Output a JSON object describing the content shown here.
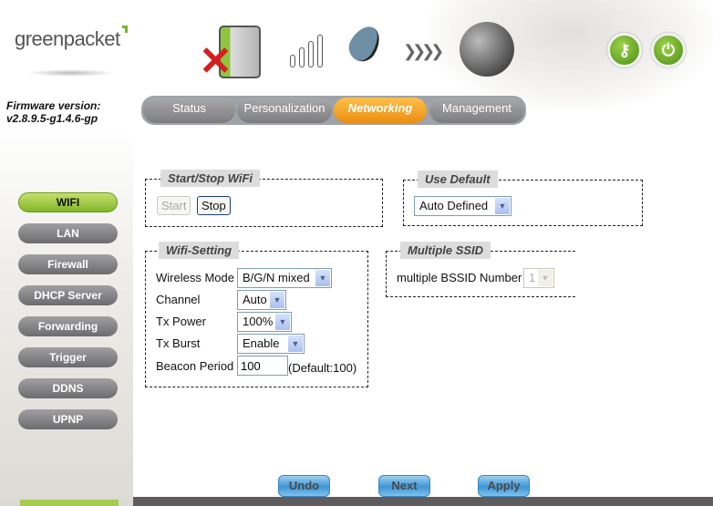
{
  "brand": {
    "logo": "greenpacket"
  },
  "firmware": {
    "label": "Firmware version:",
    "version": "v2.8.9.5-g1.4.6-gp"
  },
  "status_icons": [
    "device-disconnected-icon",
    "signal-bars-icon",
    "satellite-dish-icon",
    "arrows-icon",
    "globe-icon"
  ],
  "header_buttons": [
    {
      "icon": "key-icon"
    },
    {
      "icon": "power-icon"
    }
  ],
  "tabs": [
    {
      "label": "Status"
    },
    {
      "label": "Personalization"
    },
    {
      "label": "Networking",
      "active": true
    },
    {
      "label": "Management"
    }
  ],
  "sidebar": {
    "items": [
      {
        "label": "WIFI",
        "active": true
      },
      {
        "label": "LAN"
      },
      {
        "label": "Firewall"
      },
      {
        "label": "DHCP Server"
      },
      {
        "label": "Forwarding"
      },
      {
        "label": "Trigger"
      },
      {
        "label": "DDNS"
      },
      {
        "label": "UPNP"
      }
    ]
  },
  "start_stop": {
    "legend": "Start/Stop WiFi",
    "start": "Start",
    "stop": "Stop"
  },
  "use_default": {
    "legend": "Use Default",
    "value": "Auto Defined"
  },
  "wifi_setting": {
    "legend": "Wifi-Setting",
    "wireless_mode": {
      "label": "Wireless Mode",
      "value": "B/G/N mixed"
    },
    "channel": {
      "label": "Channel",
      "value": "Auto"
    },
    "tx_power": {
      "label": "Tx Power",
      "value": "100%"
    },
    "tx_burst": {
      "label": "Tx Burst",
      "value": "Enable"
    },
    "beacon_period": {
      "label": "Beacon Period",
      "value": "100",
      "hint": "(Default:100)"
    }
  },
  "multiple_ssid": {
    "legend": "Multiple SSID",
    "label": "multiple BSSID Number",
    "value": "1"
  },
  "footer": {
    "undo": "Undo",
    "next": "Next",
    "apply": "Apply"
  },
  "colors": {
    "accent_green": "#84b52a",
    "active_tab": "#eb8d10",
    "footer_bar": "#5e5c5d"
  }
}
